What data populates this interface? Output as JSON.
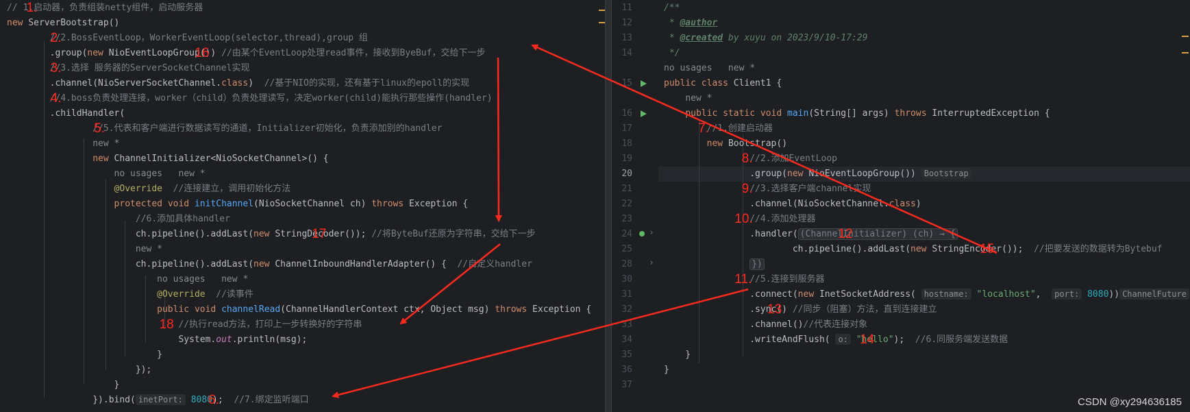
{
  "left": {
    "lines": [
      {
        "segs": [
          [
            "cm",
            "// 1.启动器，负责组装netty组件，启动服务器"
          ]
        ]
      },
      {
        "segs": [
          [
            "kw",
            "new "
          ],
          [
            "",
            "ServerBootstrap()"
          ]
        ]
      },
      {
        "segs": [
          [
            "",
            "        "
          ],
          [
            "cm",
            "//2.BossEventLoop，WorkerEventLoop(selector,thread),group 组"
          ]
        ]
      },
      {
        "segs": [
          [
            "",
            "        .group("
          ],
          [
            "kw",
            "new "
          ],
          [
            "",
            "NioEventLoopGroup())"
          ],
          [
            "cm",
            " //由某个EventLoop处理read事件，接收到ByeBuf，交给下一步"
          ]
        ]
      },
      {
        "segs": [
          [
            "",
            "        "
          ],
          [
            "cm",
            "//3.选择 服务器的ServerSocketChannel实现"
          ]
        ]
      },
      {
        "segs": [
          [
            "",
            "        .channel(NioServerSocketChannel."
          ],
          [
            "kw",
            "class"
          ],
          [
            "",
            ")  "
          ],
          [
            "cm",
            "//基于NIO的实现，还有基于linux的epoll的实现"
          ]
        ]
      },
      {
        "segs": [
          [
            "",
            "        "
          ],
          [
            "cm",
            "//4.boss负责处理连接，worker（child）负责处理读写，决定worker(child)能执行那些操作(handler)"
          ]
        ]
      },
      {
        "segs": [
          [
            "",
            "        .childHandler("
          ]
        ]
      },
      {
        "segs": [
          [
            "",
            "                "
          ],
          [
            "cm",
            "//5.代表和客户端进行数据读写的通道，Initializer初始化，负责添加别的handler"
          ]
        ]
      },
      {
        "segs": [
          [
            "",
            "                "
          ],
          [
            "hint",
            "new *"
          ]
        ]
      },
      {
        "segs": [
          [
            "",
            "                "
          ],
          [
            "kw",
            "new "
          ],
          [
            "",
            "ChannelInitializer<NioSocketChannel>() {"
          ]
        ]
      },
      {
        "segs": [
          [
            "",
            "                    "
          ],
          [
            "hint",
            "no usages   new *"
          ]
        ]
      },
      {
        "segs": [
          [
            "",
            "                    "
          ],
          [
            "ann",
            "@Override"
          ],
          [
            "",
            "  "
          ],
          [
            "cm",
            "//连接建立，调用初始化方法"
          ]
        ]
      },
      {
        "segs": [
          [
            "",
            "                    "
          ],
          [
            "kw",
            "protected void "
          ],
          [
            "fn",
            "initChannel"
          ],
          [
            "",
            "(NioSocketChannel ch) "
          ],
          [
            "kw",
            "throws "
          ],
          [
            "",
            "Exception {"
          ]
        ]
      },
      {
        "segs": [
          [
            "",
            "                        "
          ],
          [
            "cm",
            "//6.添加具体handler"
          ]
        ]
      },
      {
        "segs": [
          [
            "",
            "                        ch.pipeline().addLast("
          ],
          [
            "kw",
            "new "
          ],
          [
            "",
            "StringDecoder()); "
          ],
          [
            "cm",
            "//将ByteBuf还原为字符串，交给下一步"
          ]
        ]
      },
      {
        "segs": [
          [
            "",
            "                        "
          ],
          [
            "hint",
            "new *"
          ]
        ]
      },
      {
        "segs": [
          [
            "",
            "                        ch.pipeline().addLast("
          ],
          [
            "kw",
            "new "
          ],
          [
            "",
            "ChannelInboundHandlerAdapter() {  "
          ],
          [
            "cm",
            "//自定义handler"
          ]
        ]
      },
      {
        "segs": [
          [
            "",
            "                            "
          ],
          [
            "hint",
            "no usages   new *"
          ]
        ]
      },
      {
        "segs": [
          [
            "",
            "                            "
          ],
          [
            "ann",
            "@Override"
          ],
          [
            "",
            "  "
          ],
          [
            "cm",
            "//读事件"
          ]
        ]
      },
      {
        "segs": [
          [
            "",
            "                            "
          ],
          [
            "kw",
            "public void "
          ],
          [
            "fn",
            "channelRead"
          ],
          [
            "",
            "(ChannelHandlerContext ctx, Object msg) "
          ],
          [
            "kw",
            "throws "
          ],
          [
            "",
            "Exception {"
          ]
        ]
      },
      {
        "segs": [
          [
            "",
            "                                "
          ],
          [
            "cm",
            "//执行read方法，打印上一步转换好的字符串"
          ]
        ]
      },
      {
        "segs": [
          [
            "",
            "                                System."
          ],
          [
            "fld",
            "out"
          ],
          [
            "",
            ".println(msg);"
          ]
        ]
      },
      {
        "segs": [
          [
            "",
            "                            }"
          ]
        ]
      },
      {
        "segs": [
          [
            "",
            "                        });"
          ]
        ]
      },
      {
        "segs": [
          [
            "",
            "                    }"
          ]
        ]
      },
      {
        "segs": [
          [
            "",
            "                }).bind("
          ],
          [
            "inlay",
            "inetPort:"
          ],
          [
            "num",
            " 8080"
          ],
          [
            "",
            "); "
          ],
          [
            "cm",
            " //7.绑定监听端口"
          ]
        ]
      }
    ]
  },
  "right": {
    "lines": [
      {
        "n": "11",
        "segs": [
          [
            "doc",
            "/**"
          ]
        ]
      },
      {
        "n": "12",
        "segs": [
          [
            "doc",
            " * "
          ],
          [
            "doctag",
            "@author"
          ]
        ]
      },
      {
        "n": "13",
        "segs": [
          [
            "doc",
            " * "
          ],
          [
            "doctag",
            "@created"
          ],
          [
            "doc",
            " by "
          ],
          [
            "doc",
            "xuyu"
          ],
          [
            "doc",
            " on 2023/9/10-17:29"
          ]
        ]
      },
      {
        "n": "14",
        "segs": [
          [
            "doc",
            " */"
          ]
        ]
      },
      {
        "n": "",
        "segs": [
          [
            "hint",
            "no usages   new *"
          ]
        ]
      },
      {
        "n": "15",
        "segs": [
          [
            "kw",
            "public class "
          ],
          [
            "",
            "Client1 {"
          ]
        ]
      },
      {
        "n": "",
        "segs": [
          [
            "",
            "    "
          ],
          [
            "hint",
            "new *"
          ]
        ]
      },
      {
        "n": "16",
        "segs": [
          [
            "",
            "    "
          ],
          [
            "kw",
            "public static void "
          ],
          [
            "fn",
            "main"
          ],
          [
            "",
            "(String[] args) "
          ],
          [
            "kw",
            "throws "
          ],
          [
            "",
            "InterruptedException {"
          ]
        ]
      },
      {
        "n": "17",
        "segs": [
          [
            "",
            "        "
          ],
          [
            "cm",
            "//1.创建启动器"
          ]
        ]
      },
      {
        "n": "18",
        "segs": [
          [
            "",
            "        "
          ],
          [
            "kw",
            "new "
          ],
          [
            "",
            "Bootstrap()"
          ]
        ]
      },
      {
        "n": "19",
        "segs": [
          [
            "",
            "                "
          ],
          [
            "cm",
            "//2.添加EventLoop"
          ]
        ]
      },
      {
        "n": "20",
        "segs": [
          [
            "",
            "                .group("
          ],
          [
            "kw",
            "new "
          ],
          [
            "",
            "NioEventLoopGroup()) "
          ],
          [
            "inlay",
            "Bootstrap"
          ]
        ]
      },
      {
        "n": "21",
        "segs": [
          [
            "",
            "                "
          ],
          [
            "cm",
            "//3.选择客户端channel实现"
          ]
        ]
      },
      {
        "n": "22",
        "segs": [
          [
            "",
            "                .channel(NioSocketChannel."
          ],
          [
            "kw",
            "class"
          ],
          [
            "",
            ")"
          ]
        ]
      },
      {
        "n": "23",
        "segs": [
          [
            "",
            "                "
          ],
          [
            "cm",
            "//4.添加处理器"
          ]
        ]
      },
      {
        "n": "24",
        "segs": [
          [
            "",
            "                .handler("
          ],
          [
            "fold",
            "(ChannelInitializer) (ch) → {"
          ]
        ]
      },
      {
        "n": "25",
        "segs": [
          [
            "",
            "                        ch.pipeline().addLast("
          ],
          [
            "kw",
            "new "
          ],
          [
            "",
            "StringEncoder()); "
          ],
          [
            "cm",
            " //把要发送的数据转为Bytebuf"
          ]
        ]
      },
      {
        "n": "28",
        "segs": [
          [
            "",
            "                "
          ],
          [
            "fold",
            "})"
          ]
        ]
      },
      {
        "n": "30",
        "segs": [
          [
            "",
            "                "
          ],
          [
            "cm",
            "//5.连接到服务器"
          ]
        ]
      },
      {
        "n": "31",
        "segs": [
          [
            "",
            "                .connect("
          ],
          [
            "kw",
            "new "
          ],
          [
            "",
            "InetSocketAddress( "
          ],
          [
            "inlay",
            "hostname:"
          ],
          [
            "str",
            " \"localhost\""
          ],
          [
            "",
            ",  "
          ],
          [
            "inlay",
            "port:"
          ],
          [
            "num",
            " 8080"
          ],
          [
            "",
            "))"
          ],
          [
            "inlay",
            "ChannelFuture"
          ]
        ]
      },
      {
        "n": "32",
        "segs": [
          [
            "",
            "                .sync() "
          ],
          [
            "cm",
            "//同步（阻塞）方法，直到连接建立"
          ]
        ]
      },
      {
        "n": "33",
        "segs": [
          [
            "",
            "                .channel()"
          ],
          [
            "cm",
            "//代表连接对象"
          ]
        ]
      },
      {
        "n": "34",
        "segs": [
          [
            "",
            "                .writeAndFlush( "
          ],
          [
            "inlay",
            "o:"
          ],
          [
            "str",
            " \"hello\""
          ],
          [
            "",
            ");  "
          ],
          [
            "cm",
            "//6.同服务端发送数据"
          ]
        ]
      },
      {
        "n": "35",
        "segs": [
          [
            "",
            "    }"
          ]
        ]
      },
      {
        "n": "36",
        "segs": [
          [
            "",
            "}"
          ]
        ]
      },
      {
        "n": "37",
        "segs": [
          [
            "",
            ""
          ]
        ]
      }
    ]
  },
  "annotations": [
    {
      "label": "1.",
      "side": "left",
      "row": 0,
      "col": 3.6
    },
    {
      "label": "2.",
      "side": "left",
      "row": 2,
      "col": 8.0
    },
    {
      "label": "16",
      "side": "left",
      "row": 3,
      "col": 34.5
    },
    {
      "label": "3.",
      "side": "left",
      "row": 4,
      "col": 8.0
    },
    {
      "label": "4.",
      "side": "left",
      "row": 6,
      "col": 8.0
    },
    {
      "label": "5.",
      "side": "left",
      "row": 8,
      "col": 16.0
    },
    {
      "label": "17",
      "side": "left",
      "row": 15,
      "col": 56.0
    },
    {
      "label": "18",
      "side": "left",
      "row": 21,
      "col": 28.0
    },
    {
      "label": "6.",
      "side": "left",
      "row": 26,
      "col": 37.0
    },
    {
      "label": "7.",
      "side": "right",
      "row": 8,
      "col": 6.3
    },
    {
      "label": "8.",
      "side": "right",
      "row": 10,
      "col": 14.3
    },
    {
      "label": "9.",
      "side": "right",
      "row": 12,
      "col": 14.3
    },
    {
      "label": "10.",
      "side": "right",
      "row": 14,
      "col": 13.0
    },
    {
      "label": "12",
      "side": "right",
      "row": 15,
      "col": 32.0
    },
    {
      "label": "15.",
      "side": "right",
      "row": 16,
      "col": 58.0
    },
    {
      "label": "11.",
      "side": "right",
      "row": 18,
      "col": 13.0
    },
    {
      "label": "13",
      "side": "right",
      "row": 20,
      "col": 19.0
    },
    {
      "label": "14",
      "side": "right",
      "row": 22,
      "col": 36.0
    }
  ],
  "watermark": "CSDN @xy294636185",
  "colors": {
    "arrow": "#ff2a1f",
    "background": "#1e1f22"
  }
}
